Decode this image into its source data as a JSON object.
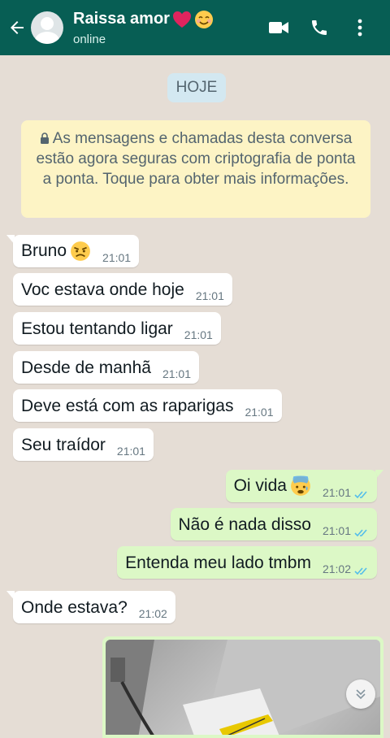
{
  "header": {
    "contact_name": "Raissa amor",
    "status": "online",
    "icons": [
      "back-arrow-icon",
      "video-call-icon",
      "phone-icon",
      "more-options-icon"
    ],
    "name_emojis": [
      "red-heart-emoji",
      "smiling-face-emoji"
    ]
  },
  "chat": {
    "date_chip": "HOJE",
    "encryption_notice": "As mensagens e chamadas desta conversa estão agora seguras com criptografia de ponta a ponta. Toque para obter mais informações.",
    "messages": [
      {
        "direction": "in",
        "text": "Bruno",
        "emoji": "angry-face-emoji",
        "time": "21:01"
      },
      {
        "direction": "in",
        "text": "Voc estava onde hoje",
        "time": "21:01"
      },
      {
        "direction": "in",
        "text": "Estou tentando ligar",
        "time": "21:01"
      },
      {
        "direction": "in",
        "text": "Desde de manhã",
        "time": "21:01"
      },
      {
        "direction": "in",
        "text": "Deve está com as raparigas",
        "time": "21:01"
      },
      {
        "direction": "in",
        "text": "Seu traídor",
        "time": "21:01"
      },
      {
        "direction": "out",
        "text": "Oi vida",
        "emoji": "anxious-face-emoji",
        "time": "21:01",
        "read": true
      },
      {
        "direction": "out",
        "text": "Não é nada disso",
        "time": "21:01",
        "read": true
      },
      {
        "direction": "out",
        "text": "Entenda meu lado tmbm",
        "time": "21:02",
        "read": true
      },
      {
        "direction": "in",
        "text": "Onde estava?",
        "time": "21:02"
      }
    ],
    "image_message": {
      "direction": "out"
    }
  },
  "colors": {
    "header": "#075e54",
    "chat_background": "#e5ddd5",
    "incoming_bubble": "#ffffff",
    "outgoing_bubble": "#dcf8c6",
    "read_ticks": "#53bdeb",
    "notice_bg": "#fdf4c5"
  }
}
